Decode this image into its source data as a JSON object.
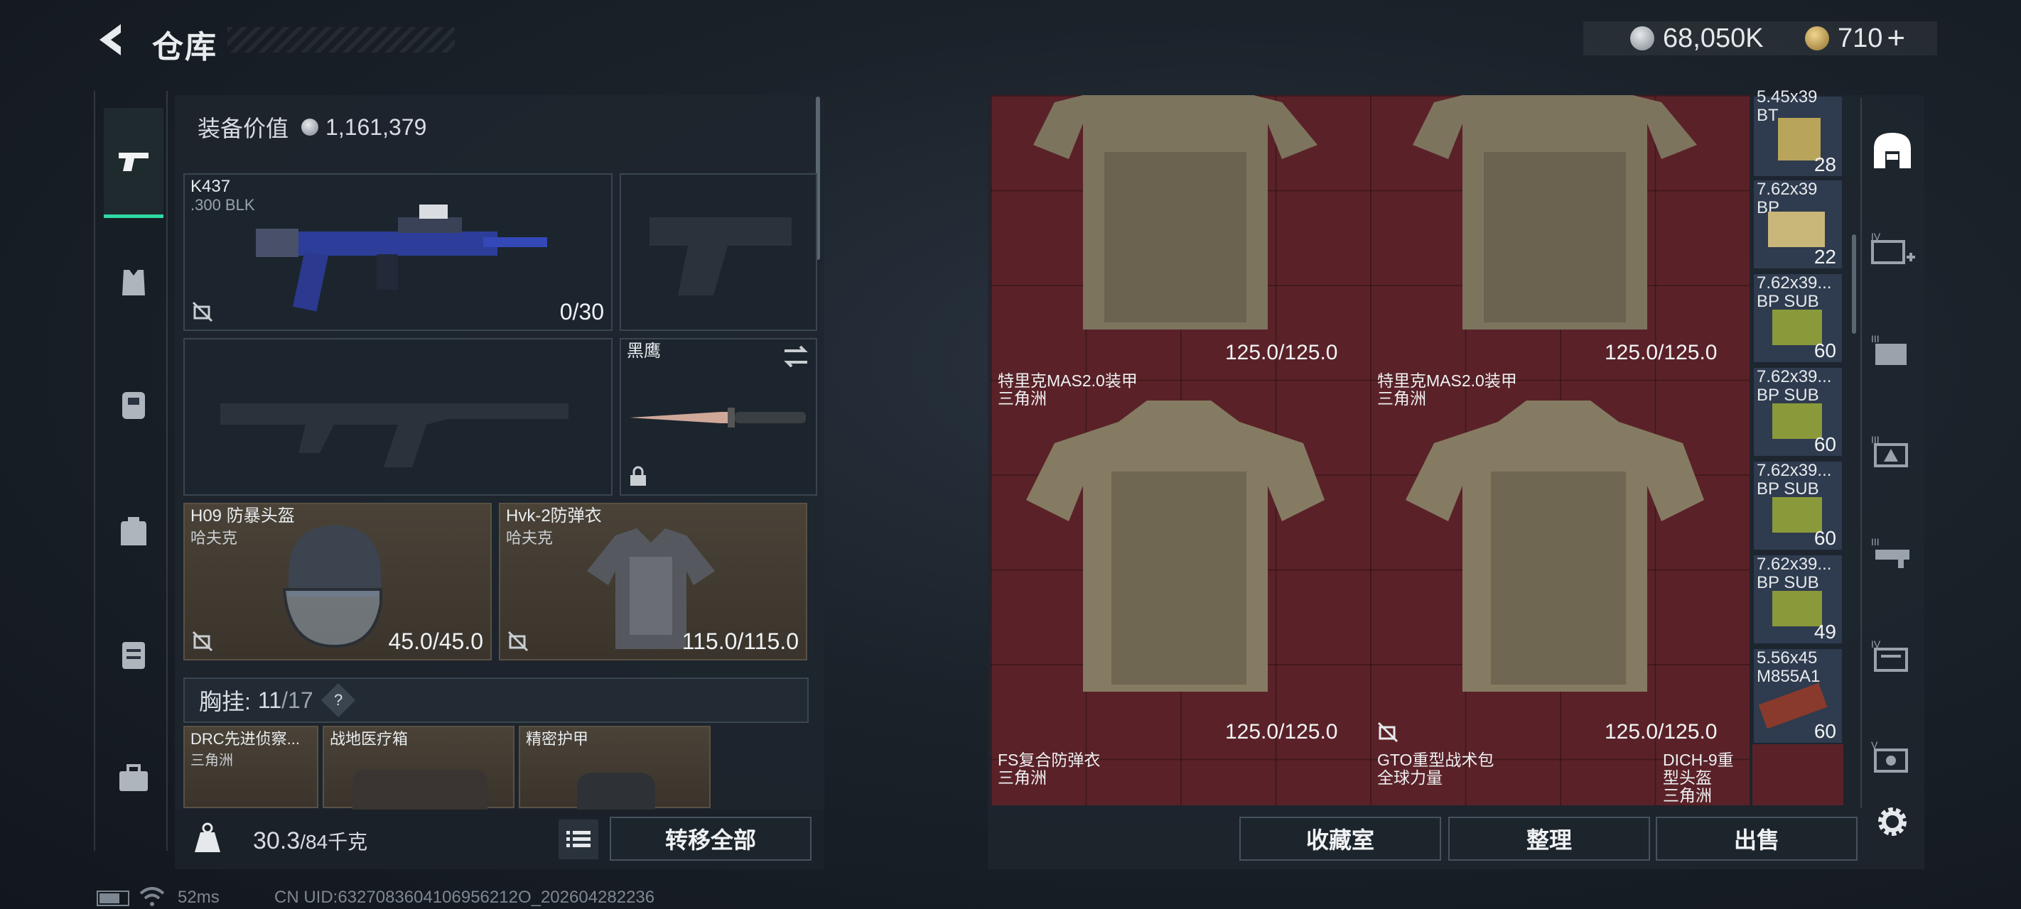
{
  "header": {
    "title": "仓库",
    "currency_main": "68,050K",
    "currency_premium": "710",
    "add_symbol": "+"
  },
  "equipment": {
    "value_label": "装备价值",
    "value": "1,161,379",
    "primary": {
      "name": "K437",
      "caliber": ".300 BLK",
      "ammo": "0/30"
    },
    "knife": {
      "name": "黑鹰"
    },
    "helmet": {
      "name": "H09 防暴头盔",
      "origin": "哈夫克",
      "durability": "45.0/45.0"
    },
    "armor": {
      "name": "Hvk-2防弹衣",
      "origin": "哈夫克",
      "durability": "115.0/115.0"
    },
    "chest_rig_label": "胸挂:",
    "chest_rig_used": "11",
    "chest_rig_total": "/17",
    "help": "?",
    "rig_items": [
      {
        "name": "DRC先进侦察...",
        "origin": "三角洲"
      },
      {
        "name": "战地医疗箱",
        "origin": ""
      },
      {
        "name": "精密护甲",
        "origin": ""
      }
    ],
    "weight": "30.3",
    "weight_total": "/84千克",
    "transfer_all": "转移全部"
  },
  "stash": {
    "top_items": [
      {
        "durability": "125.0/125.0"
      },
      {
        "durability": "125.0/125.0"
      }
    ],
    "mid_items": [
      {
        "name": "特里克MAS2.0装甲",
        "origin": "三角洲",
        "durability": "125.0/125.0"
      },
      {
        "name": "特里克MAS2.0装甲",
        "origin": "三角洲",
        "durability": "125.0/125.0"
      }
    ],
    "bottom_items": [
      {
        "name": "FS复合防弹衣",
        "origin": "三角洲"
      },
      {
        "name": "GTO重型战术包",
        "origin": "全球力量"
      },
      {
        "name": "DICH-9重型头盔",
        "origin": "三角洲"
      }
    ],
    "ammo": [
      {
        "name": "5.45x39\nBT",
        "count": "28"
      },
      {
        "name": "7.62x39\nBP",
        "count": "22"
      },
      {
        "name": "7.62x39...\nBP SUB",
        "count": "60"
      },
      {
        "name": "7.62x39...\nBP SUB",
        "count": "60"
      },
      {
        "name": "7.62x39...\nBP SUB",
        "count": "60"
      },
      {
        "name": "7.62x39...\nBP SUB",
        "count": "49"
      },
      {
        "name": "5.56x45\nM855A1",
        "count": "60"
      }
    ],
    "buttons": {
      "collection": "收藏室",
      "organize": "整理",
      "sell": "出售"
    }
  },
  "status_bar": {
    "ping": "52ms",
    "uid": "CN UID:6327083604106956212O_202604282236"
  },
  "colors": {
    "accent": "#2fd9a2",
    "grid": "#5a2228",
    "panel": "#1e262e"
  }
}
